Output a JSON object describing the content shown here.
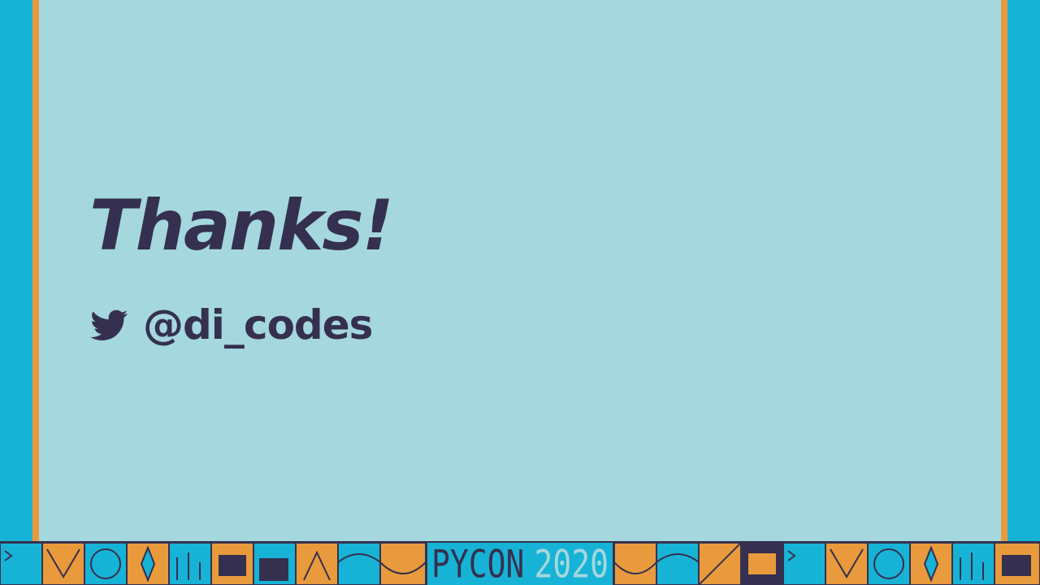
{
  "slide": {
    "title": "Thanks!",
    "twitter_icon": "twitter-bird-icon",
    "handle": "@di_codes"
  },
  "footer": {
    "logo_word_1": "PYCON",
    "logo_word_2": "2020"
  },
  "colors": {
    "outer_background": "#17b3d6",
    "slide_background": "#a5d7de",
    "frame_accent": "#e89a3c",
    "text": "#35304f"
  }
}
